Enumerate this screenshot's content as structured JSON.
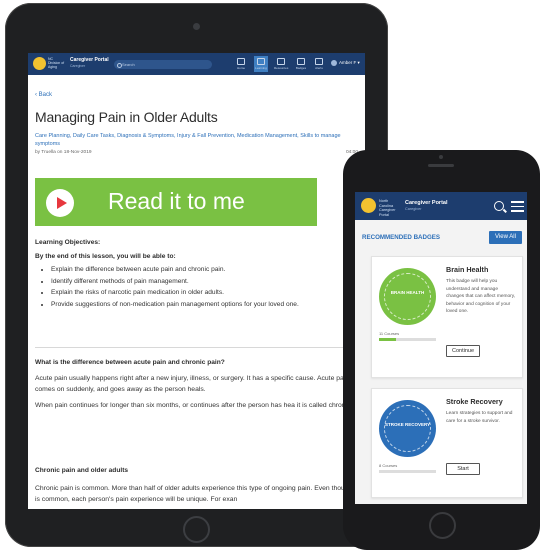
{
  "tablet": {
    "nav": {
      "brand_text": "North Carolina Caregiver Portal",
      "org_text": "NC Division of Aging",
      "portal_title": "Caregiver Portal",
      "portal_subtitle": "Caregiver",
      "search_placeholder": "Search",
      "items": [
        {
          "label": "Home",
          "active": false
        },
        {
          "label": "Learning",
          "active": true
        },
        {
          "label": "Resources",
          "active": false
        },
        {
          "label": "Badges",
          "active": false
        },
        {
          "label": "Alerts",
          "active": false
        }
      ],
      "user_name": "Amber F"
    },
    "back_label": "Back",
    "title": "Managing Pain in Older Adults",
    "tags": "Care Planning, Daily Care Tasks, Diagnosis & Symptoms, Injury & Fall Prevention, Medication Management, Skills to manage symptoms",
    "meta": "by Truella on 18-Nov-2019",
    "duration": "04:00",
    "read_banner": "Read it to me",
    "objectives_heading": "Learning Objectives:",
    "objectives_intro": "By the end of this lesson, you will be able to:",
    "objectives": [
      "Explain the difference between acute pain and chronic pain.",
      "Identify different methods of pain management.",
      "Explain the risks of narcotic pain medication in older adults.",
      "Provide suggestions of non-medication pain management options for your loved one."
    ],
    "section1_heading": "What is the difference between acute pain and chronic pain?",
    "section1_p1": "Acute pain usually happens right after a new injury, illness, or surgery. It has a specific cause. Acute pain comes on suddenly, and goes away as the person heals.",
    "section1_p2": "When pain continues for longer than six months, or continues after the person has hea it is called chronic pain. Chronic pain may be a symptom of a condition like arthritis or fibromyalgia. It can last for months to years.",
    "section2_heading": "Chronic pain and older adults",
    "section2_p1": "Chronic pain is common. More than half of older adults experience this type of ongoing pain. Even though it is common, each person's pain experience will be unique. For exan"
  },
  "phone": {
    "nav": {
      "brand_text": "North Carolina Caregiver Portal",
      "portal_title": "Caregiver Portal",
      "portal_subtitle": "Caregiver"
    },
    "recommended_heading": "RECOMMENDED BADGES",
    "view_all_label": "View All",
    "cards": [
      {
        "title": "Brain Health",
        "badge_label": "BRAIN HEALTH",
        "badge_color": "#7ac143",
        "description": "This badge will help you understand and manage changes that can affect memory, behavior and cognition of your loved one.",
        "courses": "11 Courses",
        "progress": 0.3,
        "button_label": "Continue"
      },
      {
        "title": "Stroke Recovery",
        "badge_label": "STROKE RECOVERY",
        "badge_color": "#2c6fb8",
        "description": "Learn strategies to support and care for a stroke survivor.",
        "courses": "8 Courses",
        "progress": 0,
        "button_label": "Start"
      }
    ]
  },
  "colors": {
    "nav_blue": "#1d3d6e",
    "link_blue": "#2c6fb8",
    "green": "#7ac143",
    "play_red": "#e7373e"
  }
}
